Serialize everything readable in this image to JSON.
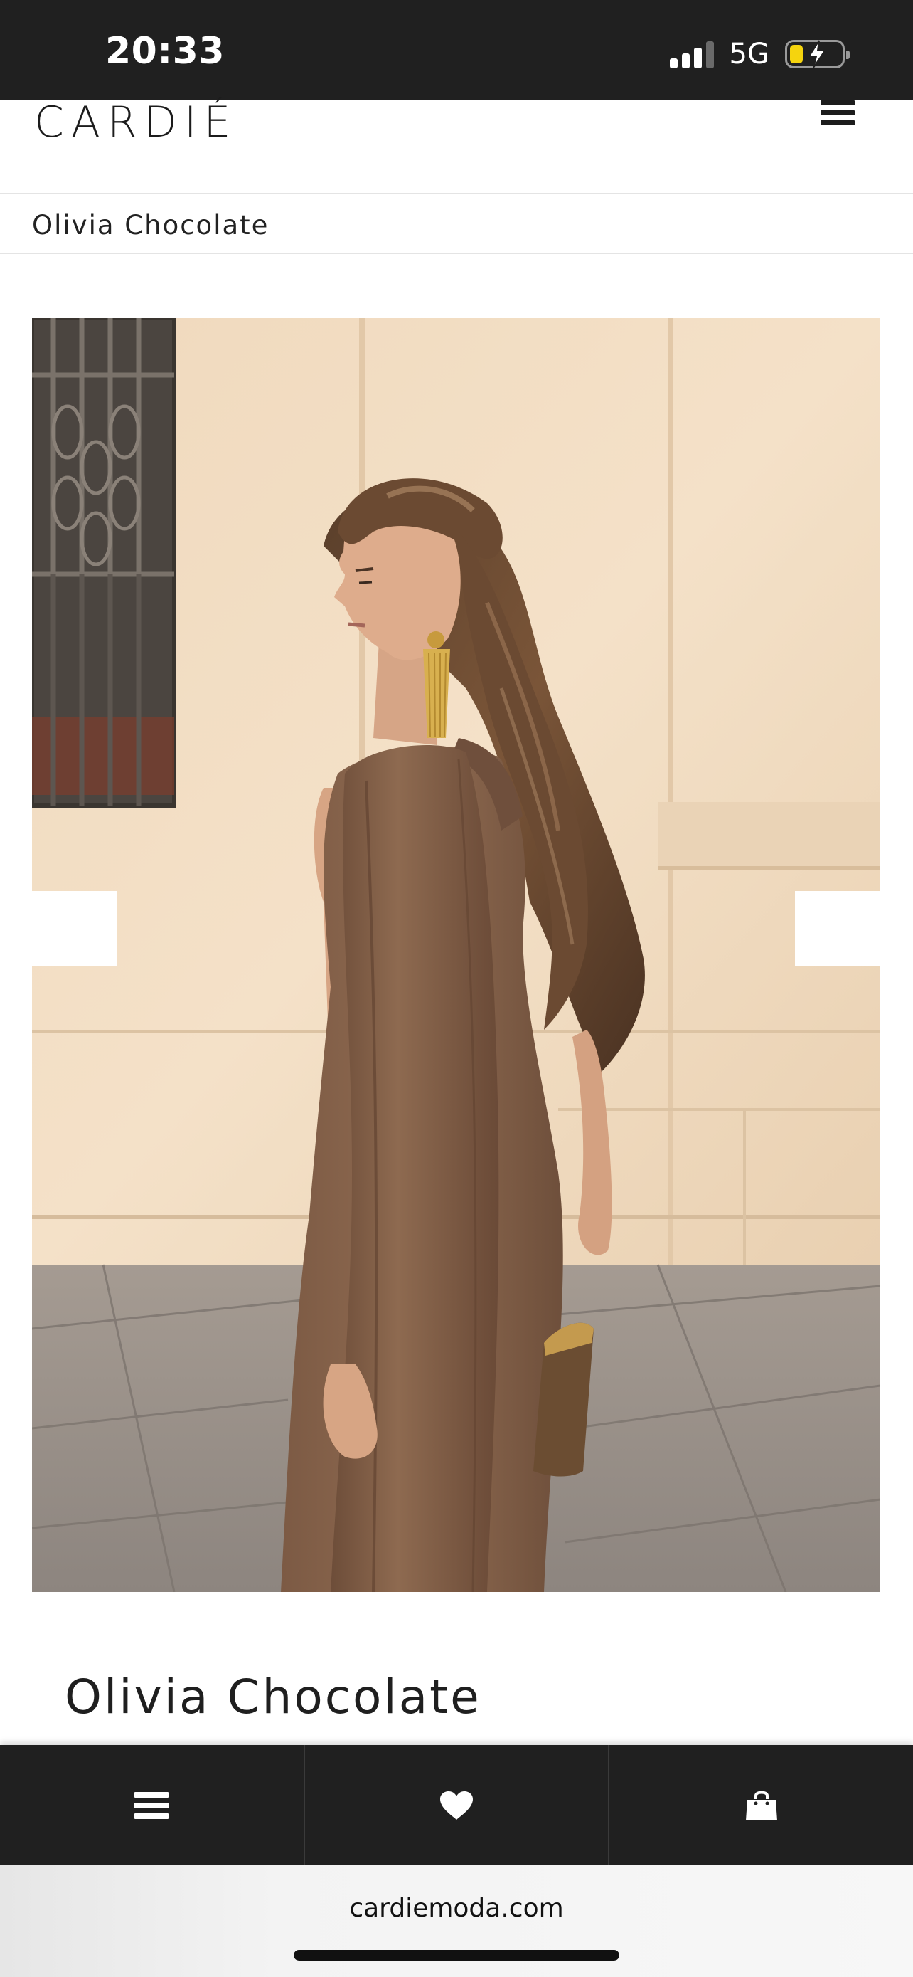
{
  "status_bar": {
    "time": "20:33",
    "network": "5G",
    "signal_bars": 4,
    "signal_active_bars": 3,
    "battery_level": 0.2,
    "battery_charging": true,
    "battery_color": "#f5d40e"
  },
  "header": {
    "logo": "CARDIÉ",
    "menu_icon": "hamburger-icon"
  },
  "breadcrumb": {
    "current": "Olivia Chocolate"
  },
  "product": {
    "image_icon": "product-photo",
    "title": "Olivia Chocolate"
  },
  "bottom_bar": {
    "items": [
      {
        "icon": "menu-icon"
      },
      {
        "icon": "heart-icon"
      },
      {
        "icon": "shopping-bag-icon"
      }
    ],
    "background": "#202020"
  },
  "browser": {
    "url": "cardiemoda.com"
  }
}
